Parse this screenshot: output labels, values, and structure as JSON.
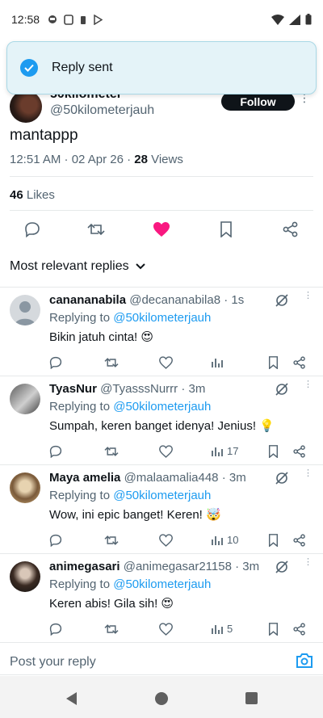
{
  "status_bar": {
    "time": "12:58"
  },
  "toast": {
    "message": "Reply sent"
  },
  "author": {
    "name": "50kilometer",
    "handle": "@50kilometerjauh",
    "follow_label": "Follow"
  },
  "tweet": {
    "text": "mantappp",
    "time": "12:51 AM · 02 Apr 26 · ",
    "views_count": "28",
    "views_label": " Views",
    "likes_count": "46",
    "likes_label": " Likes"
  },
  "replies_header": {
    "label": "Most relevant replies"
  },
  "replies": [
    {
      "name": "canananabila",
      "handle": "@decananabila8",
      "time": "· 1s",
      "replying_prefix": "Replying to ",
      "replying_to": "@50kilometerjauh",
      "text": "Bikin jatuh cinta! 😍",
      "views": ""
    },
    {
      "name": "TyasNur",
      "handle": "@TyasssNurrr",
      "time": "· 3m",
      "replying_prefix": "Replying to ",
      "replying_to": "@50kilometerjauh",
      "text": "Sumpah, keren banget idenya! Jenius! 💡",
      "views": "17"
    },
    {
      "name": "Maya amelia",
      "handle": "@malaamalia448",
      "time": "· 3m",
      "replying_prefix": "Replying to ",
      "replying_to": "@50kilometerjauh",
      "text": "Wow, ini epic banget! Keren! 🤯",
      "views": "10"
    },
    {
      "name": "animegasari",
      "handle": "@animegasar21158",
      "time": "· 3m",
      "replying_prefix": "Replying to ",
      "replying_to": "@50kilometerjauh",
      "text": "Keren abis! Gila sih! 😍",
      "views": "5"
    }
  ],
  "composer": {
    "placeholder": "Post your reply"
  },
  "colors": {
    "accent": "#1d9bf0",
    "like": "#f91880",
    "text": "#0f1419",
    "muted": "#536471"
  }
}
